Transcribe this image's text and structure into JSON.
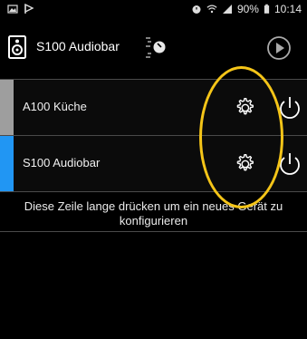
{
  "status_bar": {
    "battery_percent": "90%",
    "time": "10:14"
  },
  "toolbar": {
    "title": "S100 Audiobar",
    "icons": [
      "speaker-icon",
      "equalizer-icon",
      "list-icon",
      "play-icon"
    ]
  },
  "devices": [
    {
      "label": "A100 Küche",
      "strip_color": "#9e9e9e"
    },
    {
      "label": "S100 Audiobar",
      "strip_color": "#2196f3"
    }
  ],
  "hint": {
    "text": "Diese Zeile lange drücken um ein neues Gerät zu konfigurieren"
  },
  "colors": {
    "highlight_ring": "#f5c518",
    "background": "#000000",
    "divider": "#4a4a4a"
  }
}
